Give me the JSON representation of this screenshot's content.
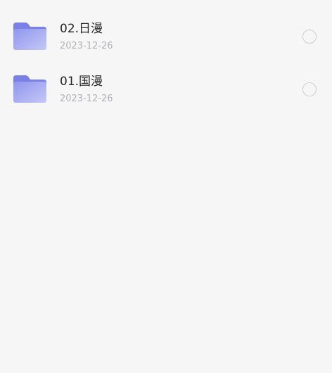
{
  "files": [
    {
      "name": "02.日漫",
      "date": "2023-12-26",
      "icon": "folder-icon",
      "selected": false
    },
    {
      "name": "01.国漫",
      "date": "2023-12-26",
      "icon": "folder-icon",
      "selected": false
    }
  ],
  "colors": {
    "background": "#f6f6f7",
    "folder_back": "#7f85e6",
    "folder_front_start": "#9aa0f0",
    "folder_front_end": "#c6c9f7",
    "name_text": "#262626",
    "date_text": "#b1b1b4",
    "radio_border": "#cfcfd2"
  }
}
